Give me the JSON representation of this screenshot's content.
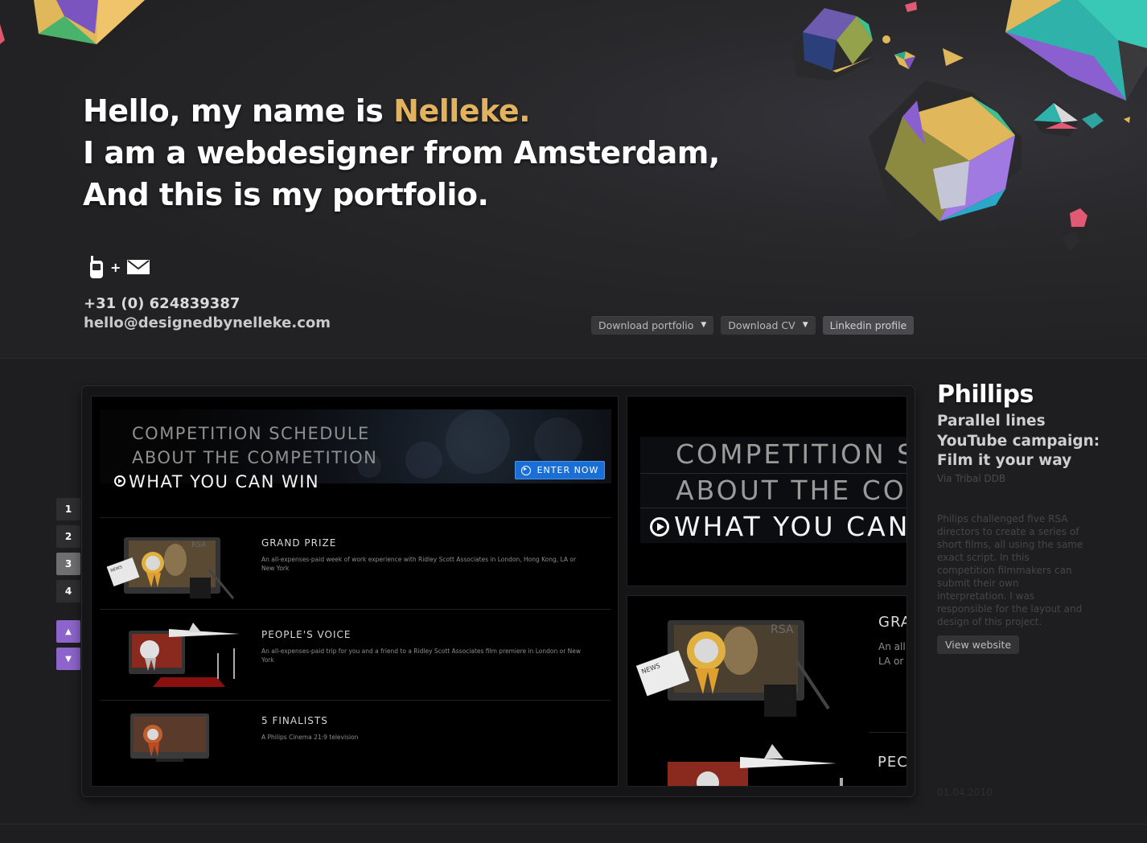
{
  "intro": {
    "line1_prefix": "Hello, my name is ",
    "line1_name": "Nelleke.",
    "line2": "I am a webdesigner from Amsterdam,",
    "line3": "And this is my portfolio."
  },
  "contact": {
    "plus": "+",
    "phone": "+31 (0) 624839387",
    "email": "hello@designedbynelleke.com"
  },
  "header_buttons": {
    "download_portfolio": "Download portfolio",
    "download_cv": "Download CV",
    "linkedin": "Linkedin profile",
    "caret_icon": "caret-down-icon"
  },
  "pager": {
    "pages": [
      "1",
      "2",
      "3",
      "4"
    ],
    "active_page": "3",
    "up_icon": "arrow-up-icon",
    "down_icon": "arrow-down-icon"
  },
  "screenshot_main": {
    "menu": [
      "COMPETITION SCHEDULE",
      "ABOUT THE COMPETITION",
      "WHAT YOU CAN WIN"
    ],
    "enter_button": "ENTER NOW",
    "prizes": [
      {
        "title": "GRAND PRIZE",
        "desc": "An all-expenses-paid week of work experience with Ridley Scott Associates in London, Hong Kong, LA or New York"
      },
      {
        "title": "PEOPLE'S VOICE",
        "desc": "An all-expenses-paid trip for you and a friend to a Ridley Scott Associates film premiere in London or New York"
      },
      {
        "title": "5 FINALISTS",
        "desc": "A Philips Cinema 21:9 television"
      }
    ],
    "tv_logo": "RSA",
    "newspaper_label": "NEWS"
  },
  "screenshot_zoom_top": {
    "menu": [
      "COMPETITION S",
      "ABOUT THE CON",
      "WHAT YOU CAN"
    ]
  },
  "screenshot_zoom_bottom": {
    "title1": "GRA",
    "desc1_line1": "An all",
    "desc1_line2": "LA or",
    "title2": "PEC",
    "tv_logo": "RSA",
    "newspaper_label": "NEWS"
  },
  "project": {
    "title": "Phillips",
    "subtitle_lines": [
      "Parallel lines",
      "YouTube campaign:",
      "Film it your way"
    ],
    "via": "Via Tribal DDB",
    "description": "Philips challenged five RSA directors to create a series of short films, all using the same exact script. In this competition filmmakers can submit their own interpretation. I was responsible for the layout and design of this project.",
    "view_button": "View website",
    "date": "01.04.2010"
  },
  "colors": {
    "accent": "#e3b25f",
    "pager_arrow": "#8d64c9",
    "enter_button": "#1a6fd6",
    "background": "#1d1d1f"
  }
}
